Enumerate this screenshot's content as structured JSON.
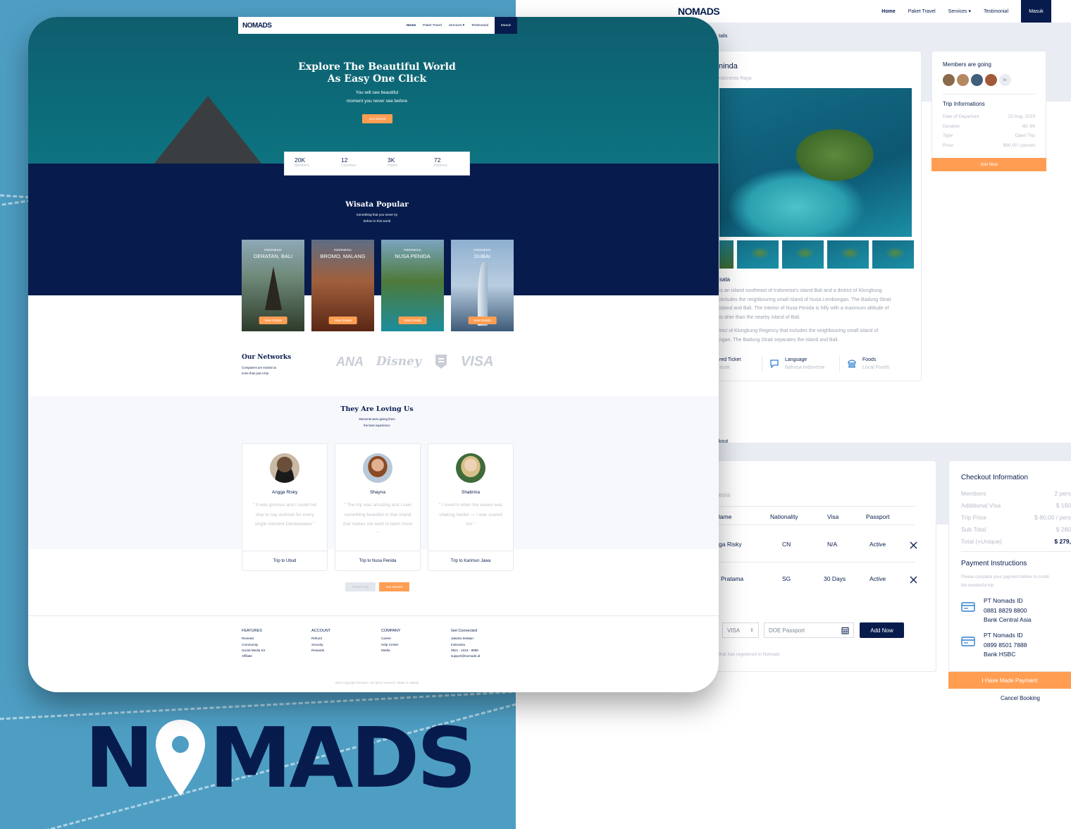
{
  "brand": "NOMADS",
  "brand_left": "N",
  "brand_right": "MADS",
  "nav": {
    "home": "Home",
    "paket": "Paket Travel",
    "services": "Services",
    "services_caret": "▾",
    "testimonial": "Testimonial",
    "masuk": "Masuk"
  },
  "hero": {
    "title_line1": "Explore The Beautiful World",
    "title_line2": "As Easy One Click",
    "sub_line1": "You will see beautiful",
    "sub_line2": "moment you never see before",
    "cta": "Get Started"
  },
  "stats": [
    {
      "value": "20K",
      "label": "Members"
    },
    {
      "value": "12",
      "label": "Countries"
    },
    {
      "value": "3K",
      "label": "Hotels"
    },
    {
      "value": "72",
      "label": "Partners"
    }
  ],
  "popular": {
    "title": "Wisata Popular",
    "sub_line1": "Something that you never try",
    "sub_line2": "before in this world",
    "cards": [
      {
        "country": "INDONESIA",
        "name": "DERATAN, BALI",
        "button": "View Details"
      },
      {
        "country": "INDONESIA",
        "name": "BROMO, MALANG",
        "button": "View Details"
      },
      {
        "country": "INDONESIA",
        "name": "NUSA PENIDA",
        "button": "View Details"
      },
      {
        "country": "INDONESIA",
        "name": "DUBAI",
        "button": "View Details"
      }
    ]
  },
  "networks": {
    "title": "Our Networks",
    "sub_line1": "Companies are trusted us",
    "sub_line2": "more than just a trip",
    "logos": [
      "ANA",
      "Disney",
      "VISA"
    ]
  },
  "loving": {
    "title": "They Are Loving Us",
    "sub_line1": "Moments were giving them",
    "sub_line2": "the best experience",
    "items": [
      {
        "name": "Angga Risky",
        "quote": "“ It was glorious and I could not stop to say wohooo for every single moment Dankeeeeee ”",
        "trip": "Trip to Ubud"
      },
      {
        "name": "Shayna",
        "quote": "“ The trip was amazing and I saw something beautiful in that Island that makes me want to learn more ”",
        "trip": "Trip to Nusa Penida"
      },
      {
        "name": "Shabrina",
        "quote": "“ I loved it when the waves was shaking harder — I was scared too ”",
        "trip": "Trip to Karimun Jawa"
      }
    ],
    "help": "I Need Help",
    "cta": "Get Started"
  },
  "footer": {
    "cols": [
      {
        "title": "FEATURES",
        "items": [
          "Reviews",
          "Community",
          "Social Media Kit",
          "Affiliate"
        ]
      },
      {
        "title": "ACCOUNT",
        "items": [
          "Refund",
          "Security",
          "Rewards"
        ]
      },
      {
        "title": "COMPANY",
        "items": [
          "Career",
          "Help Center",
          "Media"
        ]
      },
      {
        "title": "Get Connected",
        "items": [
          "Jakarta Selatan",
          "Indonesia",
          "0821 - 2222 - 8888",
          "support@nomads.id"
        ]
      }
    ],
    "copyright": "2019 Copyright Nomads • All rights reserved • Made in Jakarta"
  },
  "details": {
    "crumb": "tails",
    "title_partial": "ninda",
    "location_partial": "ndonesia Raya",
    "about_title": "sata",
    "about_p1_lines": [
      "is an island southeast of Indonesia's island Bali and a district of Klungkung",
      "includes the neighbouring small island of Nusa Lembongan. The Badung Strait",
      "island and Bali. The interior of Nusa Penida is hilly with a maximum altitude of",
      "is drier than the nearby island of Bali."
    ],
    "about_p2_lines": [
      "trict of Klungkung Regency that includes the neighbouring small island of",
      "ngan. The Badung Strait separates the island and Bali."
    ],
    "features": [
      {
        "title": "red Ticket",
        "value": "asak"
      },
      {
        "title": "Language",
        "value": "Bahasa Indonesia"
      },
      {
        "title": "Foods",
        "value": "Local Foods"
      }
    ],
    "members_title": "Members are going",
    "members_more": "9+",
    "trip_title": "Trip Informations",
    "trip_rows": [
      {
        "label": "Date of Departure",
        "value": "22 Aug, 2019"
      },
      {
        "label": "Duration",
        "value": "4D 3N"
      },
      {
        "label": "Type",
        "value": "Open Trip"
      },
      {
        "label": "Price",
        "value": "$80,00 / person"
      }
    ],
    "join": "Join Now"
  },
  "checkout": {
    "crumb": "kout",
    "subtitle_partial": "esia",
    "headers": [
      "lame",
      "Nationality",
      "Visa",
      "Passport"
    ],
    "rows": [
      {
        "name": "ga Risky",
        "nationality": "CN",
        "visa": "N/A",
        "passport": "Active"
      },
      {
        "name": "Pratama",
        "nationality": "SG",
        "visa": "30 Days",
        "passport": "Active"
      }
    ],
    "visa_select": "VISA",
    "passport_placeholder": "DOE Passport",
    "add_now": "Add Now",
    "note": "that has registered in Nomads",
    "info_title": "Checkout Information",
    "info_rows": [
      {
        "label": "Members",
        "value": "2 pers"
      },
      {
        "label": "Additional Visa",
        "value": "$ 190"
      },
      {
        "label": "Trip Price",
        "value": "$ 80,00 / pers"
      },
      {
        "label": "Sub Total",
        "value": "$ 280"
      },
      {
        "label": "Total (+Unique)",
        "value": "$ 279,"
      }
    ],
    "pay_title": "Payment Instructions",
    "pay_sub_line1": "Please complete your payment before to contin",
    "pay_sub_line2": "the wonderful trip",
    "banks": [
      {
        "name": "PT Nomads ID",
        "number": "0881 8829 8800",
        "bank": "Bank Central Asia"
      },
      {
        "name": "PT Nomads ID",
        "number": "0899 8501 7888",
        "bank": "Bank HSBC"
      }
    ],
    "paid": "I Have Made Payment",
    "cancel": "Cancel Booking"
  },
  "colors": {
    "navy": "#071c4d",
    "orange": "#ff9e53",
    "sea": "#4e9ec4"
  },
  "icons": [
    "close-icon",
    "chat-icon",
    "food-icon",
    "ticket-icon",
    "card-icon",
    "calendar-icon",
    "map-pin-icon"
  ]
}
